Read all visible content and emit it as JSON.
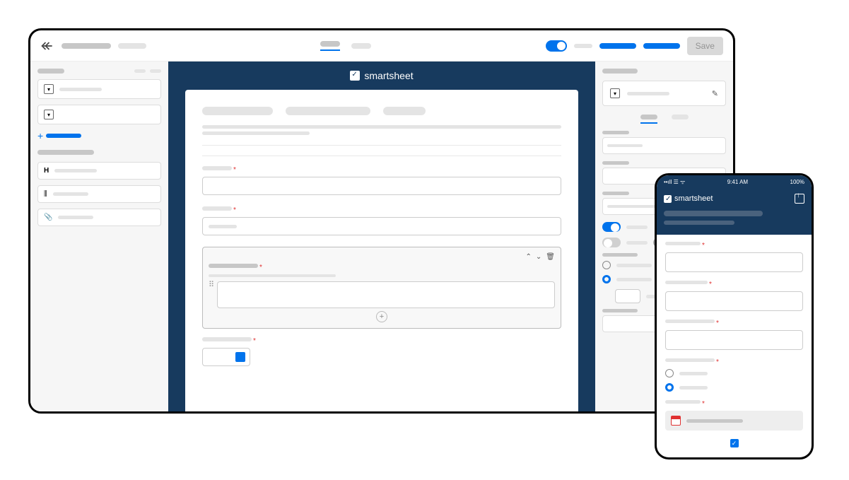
{
  "toolbar": {
    "save_label": "Save"
  },
  "brand": {
    "name": "smartsheet"
  },
  "mobile": {
    "status_center": "9:41 AM",
    "status_right": "100%",
    "brand": "smartsheet"
  },
  "colors": {
    "accent": "#0073ec",
    "header_navy": "#173a5e",
    "required": "#e03131"
  }
}
